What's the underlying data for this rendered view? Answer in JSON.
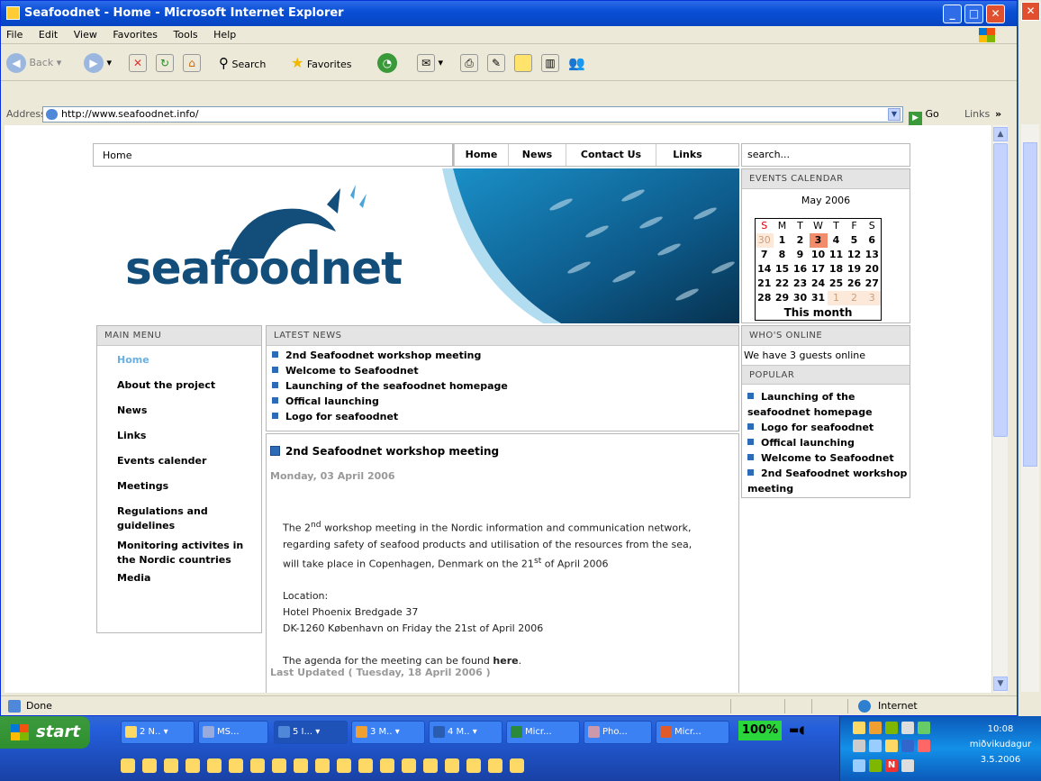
{
  "window": {
    "title": "Seafoodnet - Home - Microsoft Internet Explorer"
  },
  "menubar": [
    "File",
    "Edit",
    "View",
    "Favorites",
    "Tools",
    "Help"
  ],
  "toolbar": {
    "back": "Back",
    "search": "Search",
    "favorites": "Favorites"
  },
  "address": {
    "label": "Address",
    "url": "http://www.seafoodnet.info/",
    "go": "Go",
    "links": "Links"
  },
  "status": {
    "text": "Done",
    "zone": "Internet"
  },
  "page": {
    "breadcrumb": "Home",
    "topnav": [
      "Home",
      "News",
      "Contact Us",
      "Links"
    ],
    "search_placeholder": "search...",
    "logo_text": "seafoodnet",
    "calendar": {
      "header": "EVENTS CALENDAR",
      "month": "May 2006",
      "days": [
        "S",
        "M",
        "T",
        "W",
        "T",
        "F",
        "S"
      ],
      "weeks": [
        [
          "30",
          "1",
          "2",
          "3",
          "4",
          "5",
          "6"
        ],
        [
          "7",
          "8",
          "9",
          "10",
          "11",
          "12",
          "13"
        ],
        [
          "14",
          "15",
          "16",
          "17",
          "18",
          "19",
          "20"
        ],
        [
          "21",
          "22",
          "23",
          "24",
          "25",
          "26",
          "27"
        ],
        [
          "28",
          "29",
          "30",
          "31",
          "1",
          "2",
          "3"
        ]
      ],
      "footer": "This month"
    },
    "main_menu": {
      "header": "MAIN MENU",
      "items": [
        "Home",
        "About the project",
        "News",
        "Links",
        "Events calender",
        "Meetings",
        "Regulations and guidelines",
        "Monitoring activites in the Nordic countries",
        "Media"
      ]
    },
    "latest_news": {
      "header": "LATEST NEWS",
      "items": [
        "2nd Seafoodnet workshop meeting",
        "Welcome to Seafoodnet",
        "Launching of the seafoodnet homepage",
        "Offical launching",
        "Logo for seafoodnet"
      ]
    },
    "article": {
      "title": "2nd Seafoodnet workshop meeting",
      "date": "Monday, 03 April 2006",
      "p1a": "The 2",
      "p1sup": "nd",
      "p1b": " workshop meeting in the Nordic information and communication network,",
      "p1c": "regarding safety of seafood products and utilisation of the resources from the sea,",
      "p1d": "will take place in Copenhagen, Denmark on the 21",
      "p1dsup": "st",
      "p1e": " of April 2006",
      "location_label": "Location:",
      "address1": "Hotel Phoenix Bredgade 37",
      "address2": "DK-1260 København on Friday the 21st of April 2006",
      "agenda_a": "The agenda for the meeting can be found ",
      "agenda_link": "here",
      "agenda_b": ".",
      "updated": "Last Updated ( Tuesday, 18 April 2006 )"
    },
    "whos_online": {
      "header": "WHO'S ONLINE",
      "text": "We have 3 guests online"
    },
    "popular": {
      "header": "POPULAR",
      "items": [
        "Launching of the seafoodnet homepage",
        "Logo for seafoodnet",
        "Offical launching",
        "Welcome to Seafoodnet",
        "2nd Seafoodnet workshop meeting"
      ]
    }
  },
  "taskbar": {
    "start": "start",
    "tasks": [
      "2 N..",
      "MS...",
      "5 I...",
      "3 M..",
      "4 M..",
      "Micr...",
      "Pho...",
      "Micr..."
    ],
    "battery": "100%",
    "clock": {
      "time": "10:08",
      "day": "miðvikudagur",
      "date": "3.5.2006"
    }
  },
  "colors": {
    "accent": "#2c6bb7",
    "logo_dark": "#134e7a",
    "logo_light": "#4aa6d8",
    "today": "#f28c6b"
  }
}
